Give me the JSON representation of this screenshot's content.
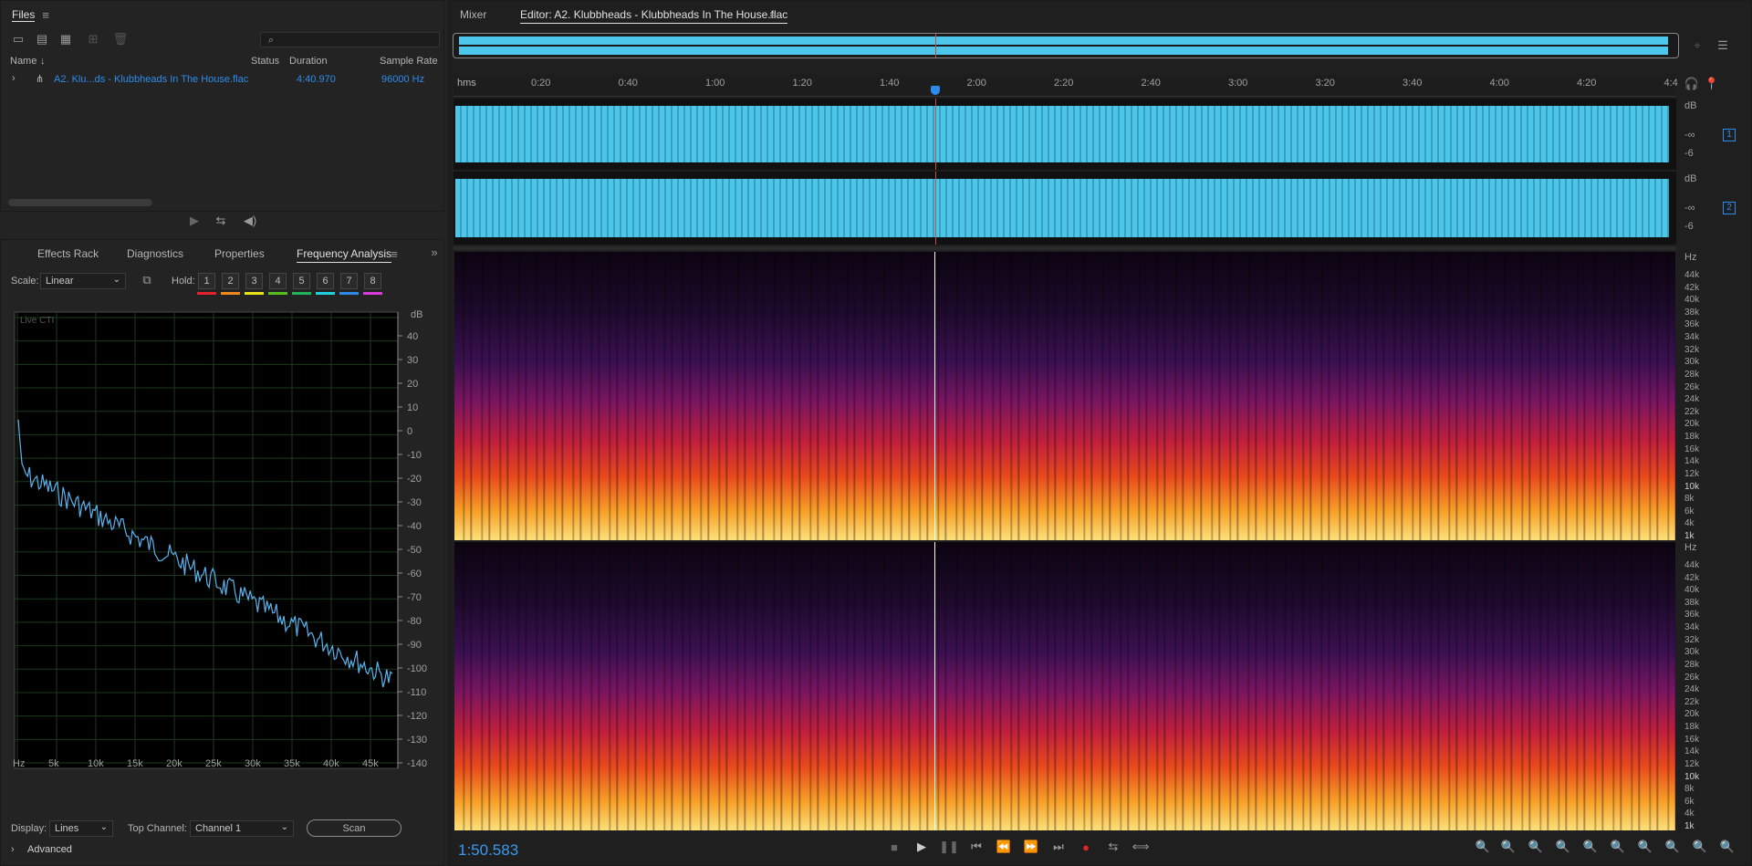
{
  "files_panel": {
    "title": "Files",
    "columns": [
      "Name",
      "Status",
      "Duration",
      "Sample Rate"
    ],
    "file": {
      "name": "A2. Klu...ds - Klubbheads In The House.flac",
      "duration": "4:40.970",
      "sample_rate": "96000 Hz"
    }
  },
  "tabs_bottom": [
    "Effects Rack",
    "Diagnostics",
    "Properties",
    "Frequency Analysis"
  ],
  "freq": {
    "scale_label": "Scale:",
    "scale_value": "Linear",
    "hold_label": "Hold:",
    "holds": [
      "1",
      "2",
      "3",
      "4",
      "5",
      "6",
      "7",
      "8"
    ],
    "hold_colors": [
      "#e5212b",
      "#f08a1e",
      "#e8e21c",
      "#57c020",
      "#21b35a",
      "#1ed0e0",
      "#2f8be8",
      "#d93adc"
    ],
    "live_label": "Live CTI",
    "db_unit": "dB",
    "db_ticks": [
      "40",
      "30",
      "20",
      "10",
      "0",
      "-10",
      "-20",
      "-30",
      "-40",
      "-50",
      "-60",
      "-70",
      "-80",
      "-90",
      "-100",
      "-110",
      "-120",
      "-130",
      "-140"
    ],
    "hz_ticks": [
      "Hz",
      "5k",
      "10k",
      "15k",
      "20k",
      "25k",
      "30k",
      "35k",
      "40k",
      "45k"
    ],
    "display_label": "Display:",
    "display_value": "Lines",
    "top_channel_label": "Top Channel:",
    "top_channel_value": "Channel 1",
    "scan_label": "Scan",
    "advanced_label": "Advanced"
  },
  "editor": {
    "mixer_tab": "Mixer",
    "editor_tab": "Editor: A2. Klubbheads - Klubbheads In The House.flac",
    "ruler_unit": "hms",
    "ruler_ticks": [
      "0:20",
      "0:40",
      "1:00",
      "1:20",
      "1:40",
      "2:00",
      "2:20",
      "2:40",
      "3:00",
      "3:20",
      "3:40",
      "4:00",
      "4:20",
      "4:4"
    ],
    "db_labels": [
      "dB",
      "-∞",
      "-6"
    ],
    "channel_badges": [
      "1",
      "2"
    ],
    "hz_unit": "Hz",
    "hz_labels": [
      "44k",
      "42k",
      "40k",
      "38k",
      "36k",
      "34k",
      "32k",
      "30k",
      "28k",
      "26k",
      "24k",
      "22k",
      "20k",
      "18k",
      "16k",
      "14k",
      "12k",
      "10k",
      "8k",
      "6k",
      "4k",
      "1k"
    ],
    "time_display": "1:50.583"
  }
}
